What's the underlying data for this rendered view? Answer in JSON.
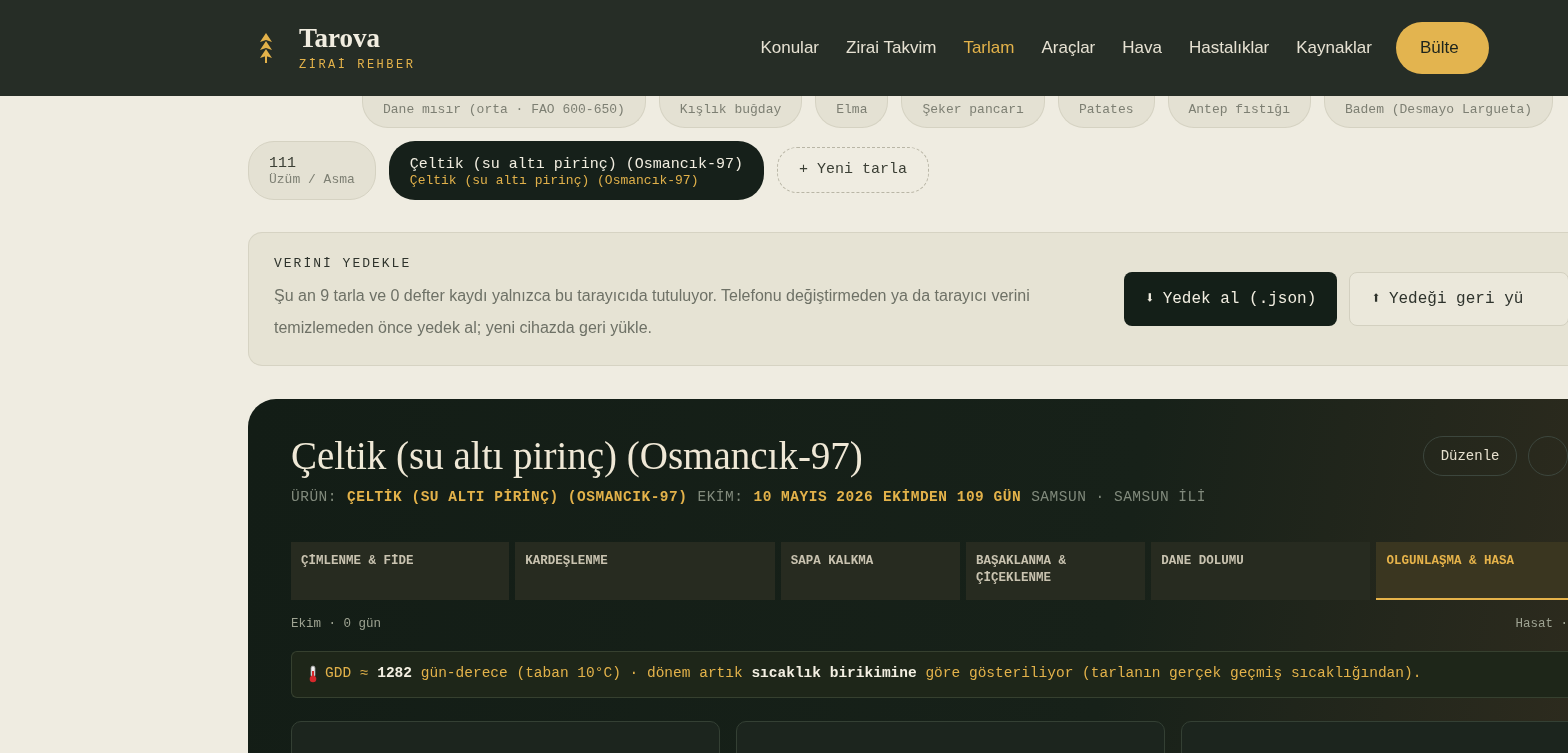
{
  "header": {
    "logo": {
      "name": "Tarova",
      "tagline": "ZİRAİ REHBER"
    },
    "nav": [
      {
        "label": "Konular",
        "selected": false
      },
      {
        "label": "Zirai Takvim",
        "selected": false
      },
      {
        "label": "Tarlam",
        "selected": true
      },
      {
        "label": "Araçlar",
        "selected": false
      },
      {
        "label": "Hava",
        "selected": false
      },
      {
        "label": "Hastalıklar",
        "selected": false
      },
      {
        "label": "Kaynaklar",
        "selected": false
      }
    ],
    "cta": "Bülte"
  },
  "fields": {
    "upper_row": [
      {
        "crop": "Dane mısır (orta · FAO 600-650)",
        "selected": false
      },
      {
        "crop": "Kışlık buğday",
        "selected": false
      },
      {
        "crop": "Elma",
        "selected": false
      },
      {
        "crop": "Şeker pancarı",
        "selected": false
      },
      {
        "crop": "Patates",
        "selected": false
      },
      {
        "crop": "Antep fıstığı",
        "selected": false
      },
      {
        "crop": "Badem (Desmayo Largueta)",
        "selected": false
      }
    ],
    "lower_row": [
      {
        "name": "111",
        "crop": "Üzüm / Asma",
        "selected": false
      },
      {
        "name": "Çeltik (su altı pirinç) (Osmancık-97)",
        "crop": "Çeltik (su altı pirinç) (Osmancık-97)",
        "selected": true
      }
    ],
    "add": "+ Yeni tarla"
  },
  "backup": {
    "title": "VERİNİ YEDEKLE",
    "text": "Şu an 9 tarla ve 0 defter kaydı yalnızca bu tarayıcıda tutuluyor. Telefonu değiştirmeden ya da tarayıcı verini temizlemeden önce yedek al; yeni cihazda geri yükle.",
    "buttons": [
      {
        "arrow": "⬇",
        "label": "Yedek al (.json)",
        "primary": true
      },
      {
        "arrow": "⬆",
        "label": "Yedeği geri yü",
        "primary": false
      }
    ]
  },
  "field": {
    "title": "Çeltik (su altı pirinç) (Osmancık-97)",
    "edit": "Düzenle",
    "meta": [
      {
        "text": "ÜRÜN:",
        "highlighted": false
      },
      {
        "text": "ÇELTİK (SU ALTI PİRİNÇ) (OSMANCIK-97)",
        "highlighted": true
      },
      {
        "text": "EKİM:",
        "highlighted": false
      },
      {
        "text": "10 MAYIS 2026",
        "highlighted": true
      },
      {
        "text": "EKİMDEN 109 GÜN",
        "highlighted": true
      },
      {
        "text": "SAMSUN · SAMSUN İLİ",
        "highlighted": false
      }
    ],
    "stages": [
      {
        "label": "ÇİMLENME & FİDE",
        "selected": false
      },
      {
        "label": "KARDEŞLENME",
        "selected": false
      },
      {
        "label": "SAPA KALKMA",
        "selected": false
      },
      {
        "label": "BAŞAKLANMA & ÇİÇEKLENME",
        "selected": false
      },
      {
        "label": "DANE DOLUMU",
        "selected": false
      },
      {
        "label": "OLGUNLAŞMA & HASA",
        "selected": true
      }
    ],
    "timeline_start": "Ekim · 0 gün",
    "timeline_end": "Hasat ·",
    "gdd_note": "GDD ≈ **1282** gün-derece (taban 10°C) · dönem artık **sıcaklık birikimine** göre gösteriliyor (tarlanın gerçek geçmiş sıcaklığından)."
  }
}
